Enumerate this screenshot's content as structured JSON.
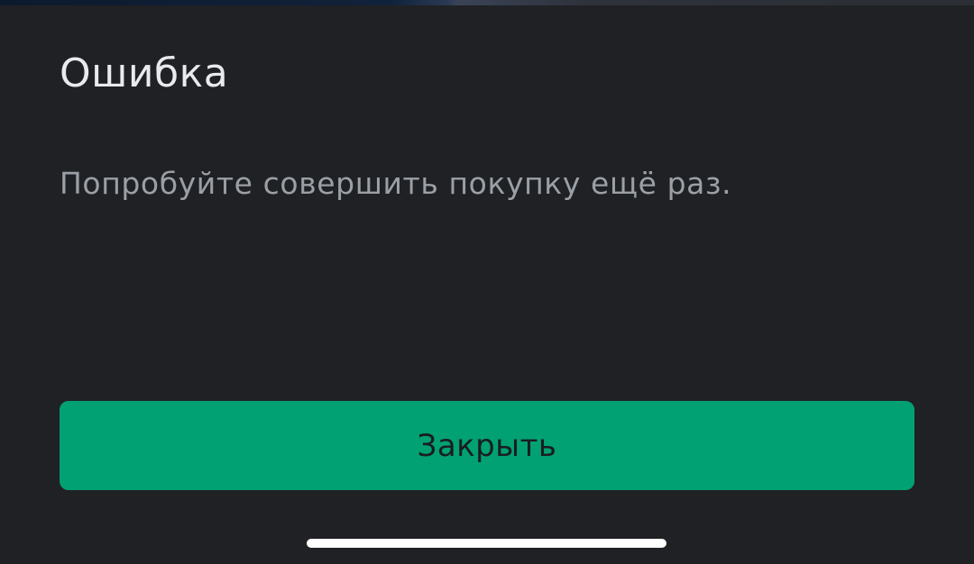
{
  "dialog": {
    "title": "Ошибка",
    "message": "Попробуйте совершить покупку ещё раз.",
    "close_label": "Закрыть"
  },
  "colors": {
    "background": "#202124",
    "title_text": "#e8eaed",
    "message_text": "#9aa0a6",
    "button_background": "#01a173",
    "button_text": "#1b1d20",
    "home_indicator": "#ffffff"
  }
}
